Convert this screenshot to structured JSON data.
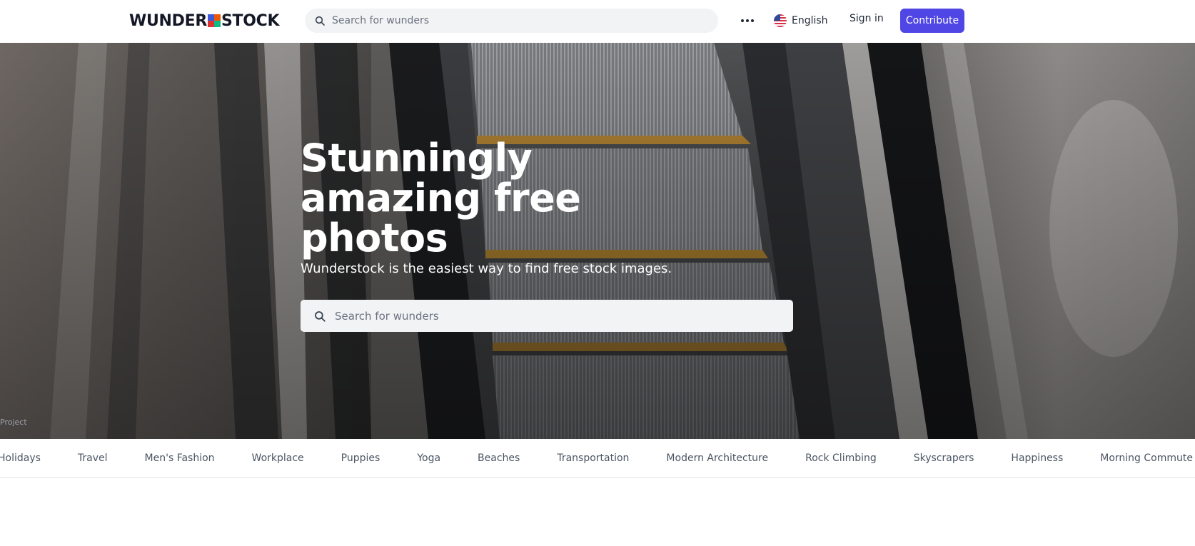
{
  "header": {
    "logo_left": "WUNDER",
    "logo_right": "STOCK",
    "search_placeholder": "Search for wunders",
    "language_label": "English",
    "signin_label": "Sign in",
    "contribute_label": "Contribute"
  },
  "hero": {
    "title": "Stunningly amazing free photos",
    "subtitle": "Wunderstock is the easiest way to find free stock images.",
    "search_placeholder": "Search for wunders",
    "photo_credit": "Project"
  },
  "categories": [
    "Holidays",
    "Travel",
    "Men's Fashion",
    "Workplace",
    "Puppies",
    "Yoga",
    "Beaches",
    "Transportation",
    "Modern Architecture",
    "Rock Climbing",
    "Skyscrapers",
    "Happiness",
    "Morning Commute"
  ],
  "colors": {
    "accent": "#4f46e5",
    "search_bg": "#f1f3f5",
    "text_dark": "#141826"
  },
  "icons": {
    "search": "search-icon",
    "more": "more-horizontal-icon",
    "flag": "us-flag-icon"
  }
}
